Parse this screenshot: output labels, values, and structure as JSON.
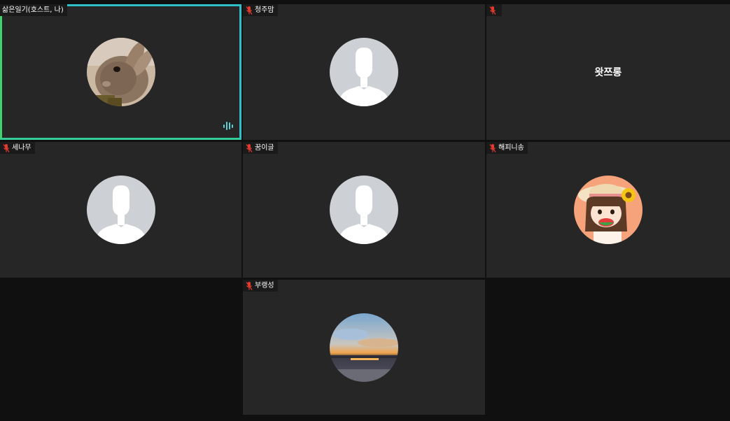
{
  "participants": [
    {
      "name": "삶은일기(호스트, 나)",
      "muted": false,
      "speaking": true,
      "avatar": "rabbit-photo"
    },
    {
      "name": "청주맘",
      "muted": true,
      "avatar": "default-silhouette"
    },
    {
      "name": "",
      "muted": true,
      "avatar": "text-only",
      "display_name": "왓쯔롱"
    },
    {
      "name": "세나무",
      "muted": true,
      "avatar": "default-silhouette"
    },
    {
      "name": "꿈이글",
      "muted": true,
      "avatar": "default-silhouette"
    },
    {
      "name": "해피니송",
      "muted": true,
      "avatar": "cartoon-girl"
    },
    {
      "name": "부랭성",
      "muted": true,
      "avatar": "sunset-photo"
    }
  ],
  "colors": {
    "background": "#101010",
    "tile": "#262626",
    "active_border": "#2fbfc9",
    "muted_icon": "#e03b2e",
    "audio_indicator": "#5fd0d6"
  }
}
